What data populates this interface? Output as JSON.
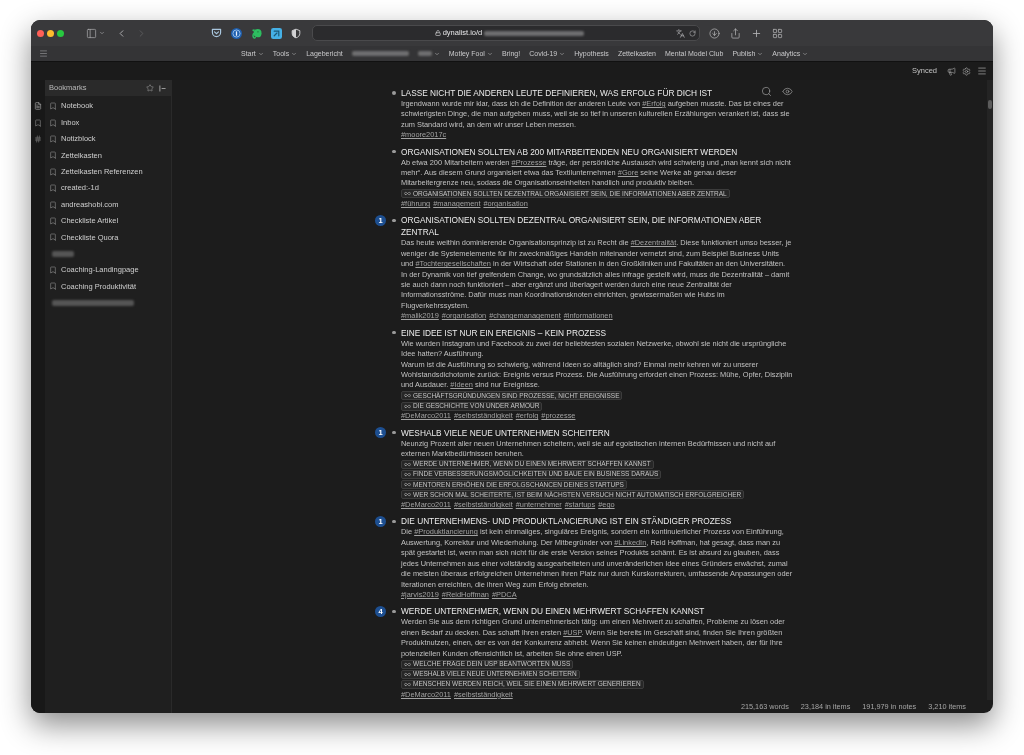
{
  "browser": {
    "url": "dynalist.io/d",
    "bookmarks": [
      {
        "kind": "link",
        "label": "Start",
        "dropdown": true
      },
      {
        "kind": "link",
        "label": "Tools",
        "dropdown": true
      },
      {
        "kind": "link",
        "label": "Lagebericht",
        "dropdown": false
      },
      {
        "kind": "redacted",
        "dropdown": false
      },
      {
        "kind": "redacted",
        "dropdown": true
      },
      {
        "kind": "link",
        "label": "Motley Fool",
        "dropdown": true
      },
      {
        "kind": "link",
        "label": "Bring!",
        "dropdown": false
      },
      {
        "kind": "link",
        "label": "Covid-19",
        "dropdown": true
      },
      {
        "kind": "link",
        "label": "Hypothesis",
        "dropdown": false
      },
      {
        "kind": "link",
        "label": "Zettelkasten",
        "dropdown": false
      },
      {
        "kind": "link",
        "label": "Mental Model Club",
        "dropdown": false
      },
      {
        "kind": "link",
        "label": "Publish",
        "dropdown": true
      },
      {
        "kind": "link",
        "label": "Analytics",
        "dropdown": true
      }
    ]
  },
  "topbar": {
    "sync_status": "Synced"
  },
  "sidebar": {
    "title": "Bookmarks",
    "items": [
      {
        "kind": "bookmark",
        "label": "Notebook"
      },
      {
        "kind": "bookmark",
        "label": "Inbox"
      },
      {
        "kind": "bookmark",
        "label": "Notizblock"
      },
      {
        "kind": "bookmark",
        "label": "Zettelkasten"
      },
      {
        "kind": "bookmark",
        "label": "Zettelkasten Referenzen"
      },
      {
        "kind": "bookmark",
        "label": "created:-1d"
      },
      {
        "kind": "bookmark",
        "label": "andreashobi.com"
      },
      {
        "kind": "bookmark",
        "label": "Checkliste Artikel"
      },
      {
        "kind": "bookmark",
        "label": "Checkliste Quora"
      },
      {
        "kind": "redacted"
      },
      {
        "kind": "bookmark",
        "label": "Coaching-Landingpage"
      },
      {
        "kind": "bookmark",
        "label": "Coaching Produktivität"
      },
      {
        "kind": "redacted"
      }
    ]
  },
  "document": {
    "items": [
      {
        "title": "LASSE NICHT DIE ANDEREN LEUTE DEFINIEREN, WAS ERFOLG FÜR DICH IST",
        "note": [
          [
            {
              "kind": "text",
              "text": "Irgendwann wurde mir klar, dass ich die Definition der anderen Leute von "
            },
            {
              "kind": "tag",
              "text": "#Erfolg"
            },
            {
              "kind": "text",
              "text": " aufgeben musste. Das ist eines der schwierigsten Dinge, die man aufgeben muss, weil sie so tief in unseren kulturellen Erzählungen verankert ist, dass sie zum Standard wird, an dem wir unser Leben messen."
            }
          ]
        ],
        "tags": [
          "#moore2017c"
        ]
      },
      {
        "title": "ORGANISATIONEN SOLLTEN AB 200 MITARBEITENDEN NEU ORGANISIERT WERDEN",
        "note": [
          [
            {
              "kind": "text",
              "text": "Ab etwa 200 Mitarbeitern werden "
            },
            {
              "kind": "tag",
              "text": "#Prozesse"
            },
            {
              "kind": "text",
              "text": " träge, der persönliche Austausch wird schwierig und „man kennt sich nicht mehr“. Aus diesem Grund organisiert etwa das Textilunternehmen "
            },
            {
              "kind": "tag",
              "text": "#Gore"
            },
            {
              "kind": "text",
              "text": " seine Werke ab genau dieser Mitarbeitergrenze neu, sodass die Organisationseinheiten handlich und produktiv bleiben."
            }
          ]
        ],
        "links": [
          "ORGANISATIONEN SOLLTEN DEZENTRAL ORGANISIERT SEIN, DIE INFORMATIONEN ABER ZENTRAL"
        ],
        "tags": [
          "#führung",
          "#management",
          "#organisation"
        ]
      },
      {
        "backlinks": "1",
        "title": "ORGANISATIONEN SOLLTEN DEZENTRAL ORGANISIERT SEIN, DIE INFORMATIONEN ABER ZENTRAL",
        "note": [
          [
            {
              "kind": "text",
              "text": "Das heute weithin dominierende Organisationsprinzip ist zu Recht die "
            },
            {
              "kind": "tag",
              "text": "#Dezentralität"
            },
            {
              "kind": "text",
              "text": ". Diese funktioniert umso besser, je weniger die Systemelemente für ihr zweckmäßiges Handeln miteinander vernetzt sind, zum Beispiel Business Units und "
            },
            {
              "kind": "tag",
              "text": "#Tochtergesellschaften"
            },
            {
              "kind": "text",
              "text": " in der Wirtschaft oder Stationen in den Großkliniken und Fakultäten an den Universitäten. In der Dynamik von tief greifendem Change, wo grundsätzlich alles infrage gestellt wird, muss die Dezentralität – damit sie auch dann noch funktioniert – aber ergänzt und überlagert werden durch eine neue Zentralität der Informationsströme. Dafür muss man Koordinationsknoten einrichten, gewissermaßen wie Hubs im Flugverkehrssystem."
            }
          ]
        ],
        "tags": [
          "#malik2019",
          "#organisation",
          "#changemanagement",
          "#informationen"
        ]
      },
      {
        "title": "EINE IDEE IST NUR EIN EREIGNIS – KEIN PROZESS",
        "note": [
          [
            {
              "kind": "text",
              "text": "Wie wurden Instagram und Facebook zu zwei der beliebtesten sozialen Netzwerke, obwohl sie nicht die ursprüngliche Idee hatten? Ausführung."
            }
          ],
          [
            {
              "kind": "text",
              "text": "Warum ist die Ausführung so schwierig, während Ideen so alltäglich sind? Einmal mehr kehren wir zu unserer Wohlstandsdichotomie zurück: Ereignis versus Prozess. Die Ausführung erfordert einen Prozess: Mühe, Opfer, Disziplin und Ausdauer. "
            },
            {
              "kind": "tag",
              "text": "#Ideen"
            },
            {
              "kind": "text",
              "text": " sind nur Ereignisse."
            }
          ]
        ],
        "links": [
          "GESCHÄFTSGRÜNDUNGEN SIND PROZESSE, NICHT EREIGNISSE",
          "DIE GESCHICHTE VON UNDER ARMOUR"
        ],
        "tags": [
          "#DeMarco2011",
          "#selbstständigkeit",
          "#erfolg",
          "#prozesse"
        ]
      },
      {
        "backlinks": "1",
        "title": "WESHALB VIELE NEUE UNTERNEHMEN SCHEITERN",
        "note": [
          [
            {
              "kind": "text",
              "text": "Neunzig Prozent aller neuen Unternehmen scheitern, weil sie auf egoistischen internen Bedürfnissen und nicht auf externen Marktbedürfnissen beruhen."
            }
          ]
        ],
        "links": [
          "WERDE UNTERNEHMER, WENN DU EINEN MEHRWERT SCHAFFEN KANNST",
          "FINDE VERBESSERUNGSMÖGLICHKEITEN UND BAUE EIN BUSINESS DARAUS",
          "MENTOREN ERHÖHEN DIE ERFOLGSCHANCEN DEINES STARTUPS",
          "WER SCHON MAL SCHEITERTE, IST BEIM NÄCHSTEN VERSUCH NICHT AUTOMATISCH ERFOLGREICHER"
        ],
        "tags": [
          "#DeMarco2011",
          "#selbstständigkeit",
          "#unternehmer",
          "#startups",
          "#ego"
        ]
      },
      {
        "backlinks": "1",
        "title": "DIE UNTERNEHMENS- UND PRODUKTLANCIERUNG IST EIN STÄNDIGER PROZESS",
        "note": [
          [
            {
              "kind": "text",
              "text": "Die "
            },
            {
              "kind": "tag",
              "text": "#Produktlancierung"
            },
            {
              "kind": "text",
              "text": " ist kein einmaliges, singuläres Ereignis, sondern ein kontinuierlicher Prozess von Einführung, Auswertung, Korrektur und Wiederholung. Der Mitbegründer von "
            },
            {
              "kind": "tag",
              "text": "#LinkedIn"
            },
            {
              "kind": "text",
              "text": ", Reid Hoffman, hat gesagt, dass man zu spät gestartet ist, wenn man sich nicht für die erste Version seines Produkts schämt. Es ist absurd zu glauben, dass jedes Unternehmen aus einer vollständig ausgearbeiteten und unveränderlichen Idee eines Gründers erwächst, zumal die meisten überaus erfolgreichen Unternehmen ihren Platz nur durch Kurskorrekturen, umfassende Anpassungen oder Iterationen erreichten, die ihren Weg zum Erfolg ebneten."
            }
          ]
        ],
        "tags": [
          "#jarvis2019",
          "#ReidHoffman",
          "#PDCA"
        ]
      },
      {
        "backlinks": "4",
        "title": "WERDE UNTERNEHMER, WENN DU EINEN MEHRWERT SCHAFFEN KANNST",
        "note": [
          [
            {
              "kind": "text",
              "text": "Werden Sie aus dem richtigen Grund unternehmerisch tätig: um einen Mehrwert zu schaffen, Probleme zu lösen oder einen Bedarf zu decken. Das schafft Ihren ersten "
            },
            {
              "kind": "tag",
              "text": "#USP"
            },
            {
              "kind": "text",
              "text": ". Wenn Sie bereits im Geschäft sind, finden Sie Ihren größten Produktnutzen, einen, der es von der Konkurrenz abhebt. Wenn Sie keinen eindeutigen Mehrwert haben, der für Ihre potenziellen Kunden offensichtlich ist, arbeiten Sie ohne einen USP."
            }
          ]
        ],
        "links": [
          "WELCHE FRAGE DEIN USP BEANTWORTEN MUSS",
          "WESHALB VIELE NEUE UNTERNEHMEN SCHEITERN",
          "MENSCHEN WERDEN REICH, WEIL SIE EINEN MEHRWERT GENERIEREN"
        ],
        "tags": [
          "#DeMarco2011",
          "#selbstständigkeit"
        ]
      }
    ]
  },
  "status_bar": [
    "215,163 words",
    "23,184 in items",
    "191,979 in notes",
    "3,210 items"
  ]
}
